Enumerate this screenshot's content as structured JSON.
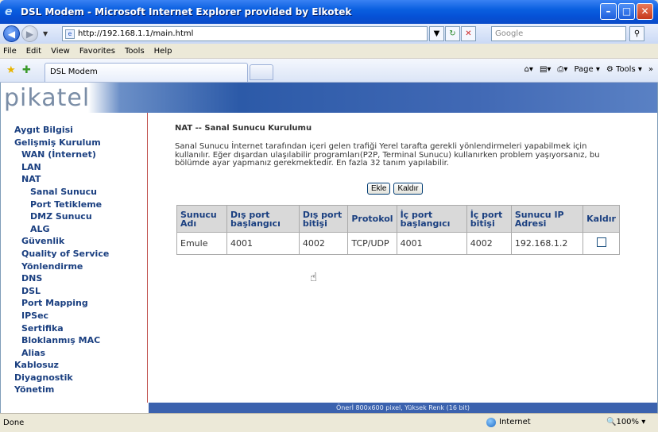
{
  "window": {
    "title": "DSL Modem - Microsoft Internet Explorer provided by Elkotek"
  },
  "address": {
    "url": "http://192.168.1.1/main.html",
    "search_placeholder": "Google"
  },
  "menu": [
    "File",
    "Edit",
    "View",
    "Favorites",
    "Tools",
    "Help"
  ],
  "tab": {
    "label": "DSL Modem"
  },
  "toolbar": {
    "page_label": "Page",
    "tools_label": "Tools"
  },
  "logo": {
    "text": "pikatel"
  },
  "sidebar": {
    "items": [
      {
        "label": "Aygıt Bilgisi",
        "level": 0
      },
      {
        "label": "Gelişmiş Kurulum",
        "level": 0
      },
      {
        "label": "WAN (İnternet)",
        "level": 1
      },
      {
        "label": "LAN",
        "level": 1
      },
      {
        "label": "NAT",
        "level": 1
      },
      {
        "label": "Sanal Sunucu",
        "level": 2
      },
      {
        "label": "Port Tetikleme",
        "level": 2
      },
      {
        "label": "DMZ Sunucu",
        "level": 2
      },
      {
        "label": "ALG",
        "level": 2
      },
      {
        "label": "Güvenlik",
        "level": 1
      },
      {
        "label": "Quality of Service",
        "level": 1
      },
      {
        "label": "Yönlendirme",
        "level": 1
      },
      {
        "label": "DNS",
        "level": 1
      },
      {
        "label": "DSL",
        "level": 1
      },
      {
        "label": "Port Mapping",
        "level": 1
      },
      {
        "label": "IPSec",
        "level": 1
      },
      {
        "label": "Sertifika",
        "level": 1
      },
      {
        "label": "Bloklanmış MAC",
        "level": 1
      },
      {
        "label": "Alias",
        "level": 1
      },
      {
        "label": "Kablosuz",
        "level": 0
      },
      {
        "label": "Diyagnostik",
        "level": 0
      },
      {
        "label": "Yönetim",
        "level": 0
      }
    ]
  },
  "main": {
    "heading": "NAT -- Sanal Sunucu Kurulumu",
    "description": "Sanal Sunucu İnternet tarafından içeri gelen trafiği Yerel tarafta gerekli yönlendirmeleri yapabilmek için kullanılır. Eğer dışardan ulaşılabilir programları(P2P, Terminal Sunucu) kullanırken problem yaşıyorsanız, bu bölümde ayar yapmanız gerekmektedir. En fazla 32 tanım yapılabilir.",
    "add_label": "Ekle",
    "remove_label": "Kaldır",
    "table": {
      "headers": [
        "Sunucu Adı",
        "Dış port başlangıcı",
        "Dış port bitişi",
        "Protokol",
        "İç port başlangıcı",
        "İç port bitişi",
        "Sunucu IP Adresi",
        "Kaldır"
      ],
      "rows": [
        {
          "name": "Emule",
          "ext_start": "4001",
          "ext_end": "4002",
          "protocol": "TCP/UDP",
          "int_start": "4001",
          "int_end": "4002",
          "ip": "192.168.1.2",
          "remove": false
        }
      ]
    }
  },
  "footer": {
    "text": "Önerİ 800x600 pixel, Yüksek Renk (16 bit)"
  },
  "status": {
    "left": "Done",
    "zone": "Internet",
    "zoom": "100%"
  }
}
